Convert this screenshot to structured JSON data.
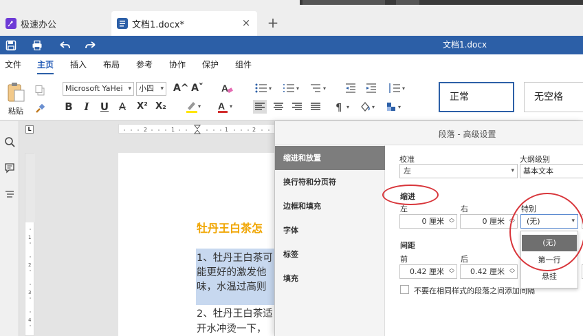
{
  "tabs": {
    "app_label": "极速办公",
    "doc_label": "文档1.docx*",
    "close_glyph": "×",
    "add_glyph": "+"
  },
  "titlebar": {
    "title": "文档1.docx"
  },
  "menu": [
    "文件",
    "主页",
    "插入",
    "布局",
    "参考",
    "协作",
    "保护",
    "组件"
  ],
  "toolbar": {
    "paste_label": "粘贴",
    "font_name": "Microsoft YaHei",
    "font_size": "小四",
    "bold": "B",
    "italic": "I",
    "underline": "U",
    "strike": "A",
    "superscript": "X²",
    "subscript": "X₂",
    "grow_font": "A^",
    "shrink_font": "Aˇ",
    "styles": [
      "正常",
      "无空格"
    ]
  },
  "document": {
    "heading": "牡丹王白茶怎",
    "lines": [
      "1、牡丹王白茶可",
      "能更好的激发他",
      "味，水温过高则",
      "2、牡丹王白茶适",
      "开水冲烫一下，"
    ]
  },
  "dialog": {
    "title": "段落 - 高级设置",
    "nav": [
      "缩进和放置",
      "换行符和分页符",
      "边框和填充",
      "字体",
      "标签",
      "填充"
    ],
    "selected_nav": "缩进和放置",
    "alignment_label": "校准",
    "alignment_value": "左",
    "outline_label": "大纲级别",
    "outline_value": "基本文本",
    "indent_section": "缩进",
    "left_label": "左",
    "left_value": "0 厘米",
    "right_label": "右",
    "right_value": "0 厘米",
    "special_label": "特别",
    "special_value": "(无)",
    "special_options": [
      "(无)",
      "第一行",
      "悬挂"
    ],
    "spacing_section": "间距",
    "before_label": "前",
    "before_value": "0.42 厘米",
    "after_label": "后",
    "after_value": "0.42 厘米",
    "no_space_checkbox": "不要在相同样式的段落之间添加间隔"
  },
  "colors": {
    "brand_blue": "#2c5fa7",
    "heading_orange": "#f0a500",
    "annotation_red": "#d8353a",
    "selection": "#c7d8ef"
  }
}
